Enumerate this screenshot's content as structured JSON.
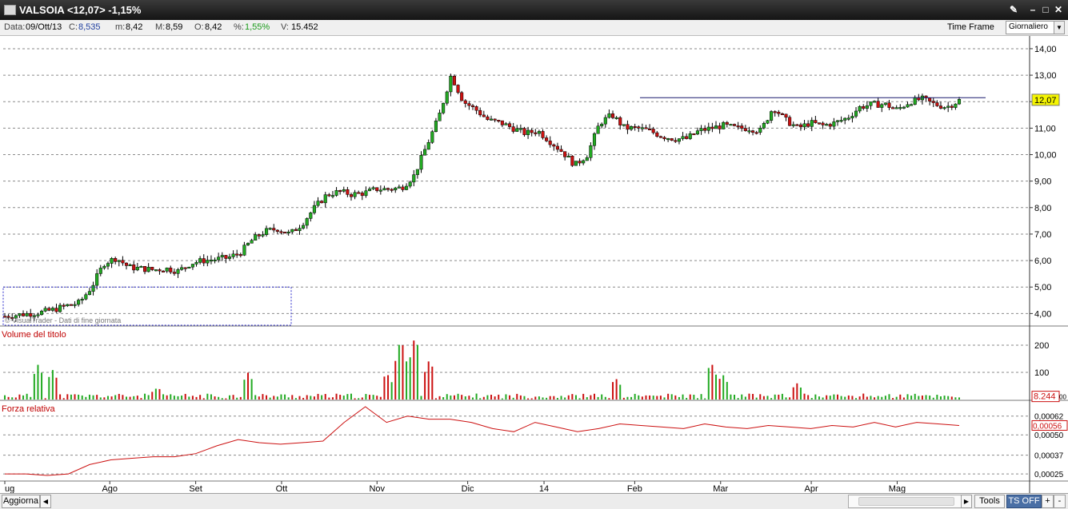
{
  "window": {
    "title": "VALSOIA <12,07> -1,15%",
    "buttons": [
      "wrench",
      "minimize",
      "maximize",
      "close"
    ]
  },
  "infobar": {
    "data_label": "Data:",
    "data_value": "09/Ott/13",
    "c_label": "C:",
    "c_value": "8,535",
    "m_label": "m:",
    "m_value": "8,42",
    "M_label": "M:",
    "M_value": "8,59",
    "o_label": "O:",
    "o_value": "8,42",
    "pct_label": "%:",
    "pct_value": "1,55%",
    "v_label": "V:",
    "v_value": "15.452",
    "time_frame_label": "Time Frame",
    "time_frame_value": "Giornaliero"
  },
  "price_panel": {
    "axis_ticks": [
      "14,00",
      "13,00",
      "12,00",
      "11,00",
      "10,00",
      "9,00",
      "8,00",
      "7,00",
      "6,00",
      "5,00",
      "4,00"
    ],
    "current_price": "12,07",
    "watermark": "© VisualTrader - Dati di fine giornata"
  },
  "volume_panel": {
    "title": "Volume del titolo",
    "axis_ticks": [
      "200",
      "100"
    ],
    "current_value": "8.244",
    "current_suffix": "00"
  },
  "rs_panel": {
    "title": "Forza relativa",
    "axis_ticks": [
      "0,00062",
      "0,00050",
      "0,00037",
      "0,00025"
    ],
    "current_value": "0,00056"
  },
  "x_axis": {
    "labels": [
      "ug",
      "Ago",
      "Set",
      "Ott",
      "Nov",
      "Dic",
      "14",
      "Feb",
      "Mar",
      "Apr",
      "Mag"
    ]
  },
  "bottombar": {
    "aggiorna": "Aggiorna",
    "tools": "Tools",
    "ts_off": "TS OFF",
    "plus": "+",
    "minus": "-"
  },
  "colors": {
    "up": "#22aa22",
    "down": "#cc1111",
    "grid": "#8a8a8a",
    "line": "#cc1111",
    "resistance": "#1a1a6e",
    "box": "#2a2acc",
    "price_tag": "#f5f500"
  },
  "chart_data": {
    "type": "candlestick",
    "x_labels": [
      "ug",
      "Ago",
      "Set",
      "Ott",
      "Nov",
      "Dic",
      "14",
      "Feb",
      "Mar",
      "Apr",
      "Mag"
    ],
    "price_range": [
      3.8,
      14.3
    ],
    "close_path": [
      3.9,
      3.95,
      4.0,
      4.05,
      4.15,
      4.3,
      4.4,
      5.0,
      5.9,
      6.1,
      5.75,
      5.7,
      5.65,
      5.7,
      5.6,
      5.9,
      6.0,
      6.05,
      6.1,
      6.3,
      6.8,
      7.1,
      7.2,
      7.0,
      7.4,
      8.0,
      8.5,
      8.6,
      8.5,
      8.55,
      8.7,
      8.7,
      8.75,
      9.2,
      10.3,
      11.4,
      13.0,
      12.0,
      11.7,
      11.3,
      11.2,
      11.0,
      10.8,
      10.9,
      10.5,
      10.1,
      9.6,
      10.0,
      11.2,
      11.5,
      11.0,
      11.0,
      10.9,
      10.7,
      10.6,
      10.6,
      10.9,
      11.0,
      11.1,
      11.0,
      11.0,
      10.9,
      11.8,
      11.3,
      11.0,
      11.2,
      11.1,
      11.2,
      11.4,
      11.8,
      11.9,
      11.9,
      11.7,
      12.0,
      12.1,
      11.9,
      11.8,
      12.05
    ],
    "resistance_level": 12.15,
    "volume_range": [
      0,
      250
    ],
    "volume_spikes": [
      {
        "x_frac": 0.035,
        "v": 130
      },
      {
        "x_frac": 0.05,
        "v": 110
      },
      {
        "x_frac": 0.16,
        "v": 45
      },
      {
        "x_frac": 0.255,
        "v": 100
      },
      {
        "x_frac": 0.4,
        "v": 100
      },
      {
        "x_frac": 0.415,
        "v": 230
      },
      {
        "x_frac": 0.43,
        "v": 240
      },
      {
        "x_frac": 0.445,
        "v": 150
      },
      {
        "x_frac": 0.64,
        "v": 80
      },
      {
        "x_frac": 0.74,
        "v": 140
      },
      {
        "x_frac": 0.752,
        "v": 95
      },
      {
        "x_frac": 0.83,
        "v": 60
      }
    ],
    "rs_range": [
      0.00023,
      0.00068
    ],
    "rs_path": [
      0.00025,
      0.00025,
      0.00024,
      0.00025,
      0.00031,
      0.00034,
      0.00035,
      0.00036,
      0.00036,
      0.00038,
      0.00043,
      0.00047,
      0.00045,
      0.00044,
      0.00045,
      0.00046,
      0.00058,
      0.00068,
      0.00058,
      0.00062,
      0.0006,
      0.0006,
      0.00058,
      0.00054,
      0.00052,
      0.00058,
      0.00055,
      0.00052,
      0.00054,
      0.00057,
      0.00056,
      0.00055,
      0.00054,
      0.00057,
      0.00055,
      0.00054,
      0.00056,
      0.00055,
      0.00054,
      0.00056,
      0.00055,
      0.00058,
      0.00055,
      0.00058,
      0.00057,
      0.00056
    ]
  }
}
